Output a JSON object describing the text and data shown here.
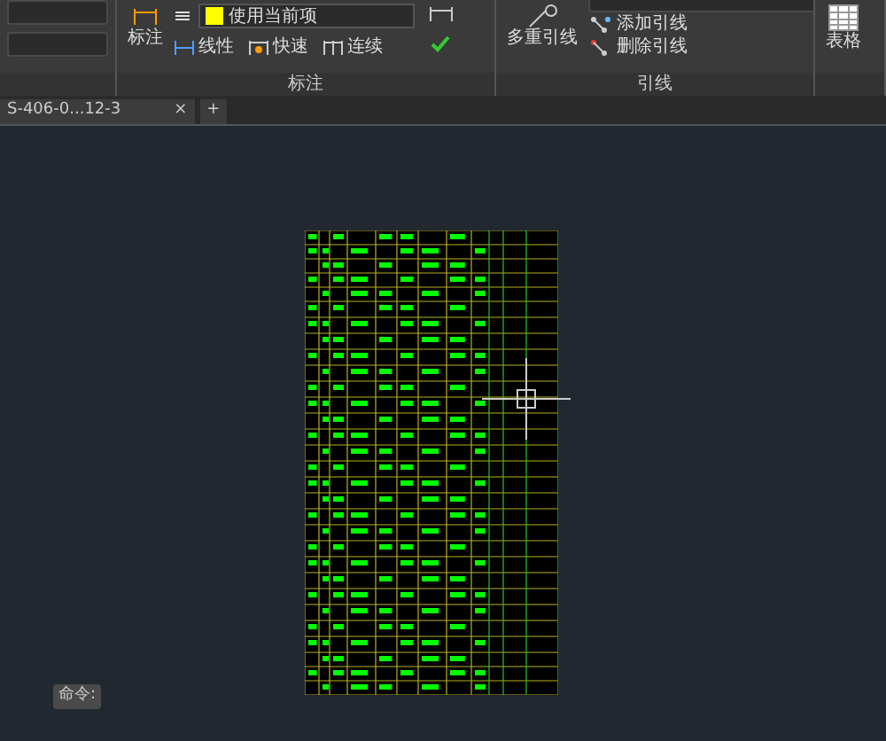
{
  "ribbon": {
    "panels": [
      {
        "kind": "fields"
      },
      {
        "kind": "dimension",
        "big_button": "标注",
        "style_select": "使用当前项",
        "tools": [
          "线性",
          "快速",
          "连续"
        ],
        "title": "标注"
      },
      {
        "kind": "leader",
        "big_button": "多重引线",
        "tools": [
          "添加引线",
          "删除引线"
        ],
        "title": "引线"
      },
      {
        "kind": "table",
        "big_button": "表格"
      }
    ]
  },
  "tabs": [
    {
      "label": "S-406-0...12-3",
      "close": "×"
    }
  ],
  "new_tab": "+",
  "command_line": {
    "prompt": "命令:"
  }
}
